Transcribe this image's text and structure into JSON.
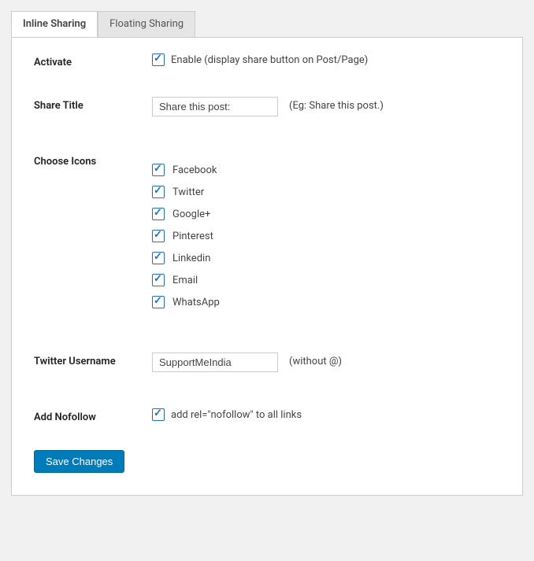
{
  "tabs": {
    "inline": "Inline Sharing",
    "floating": "Floating Sharing"
  },
  "activate": {
    "label": "Activate",
    "checked": true,
    "text": "Enable (display share button on Post/Page)"
  },
  "share_title": {
    "label": "Share Title",
    "value": "Share this post:",
    "hint": "(Eg: Share this post.)"
  },
  "choose_icons": {
    "label": "Choose Icons",
    "items": [
      {
        "name": "Facebook",
        "checked": true
      },
      {
        "name": "Twitter",
        "checked": true
      },
      {
        "name": "Google+",
        "checked": true
      },
      {
        "name": "Pinterest",
        "checked": true
      },
      {
        "name": "Linkedin",
        "checked": true
      },
      {
        "name": "Email",
        "checked": true
      },
      {
        "name": "WhatsApp",
        "checked": true
      }
    ]
  },
  "twitter_username": {
    "label": "Twitter Username",
    "value": "SupportMeIndia",
    "hint": "(without @)"
  },
  "nofollow": {
    "label": "Add Nofollow",
    "checked": true,
    "text": "add rel=\"nofollow\" to all links"
  },
  "save": "Save Changes"
}
